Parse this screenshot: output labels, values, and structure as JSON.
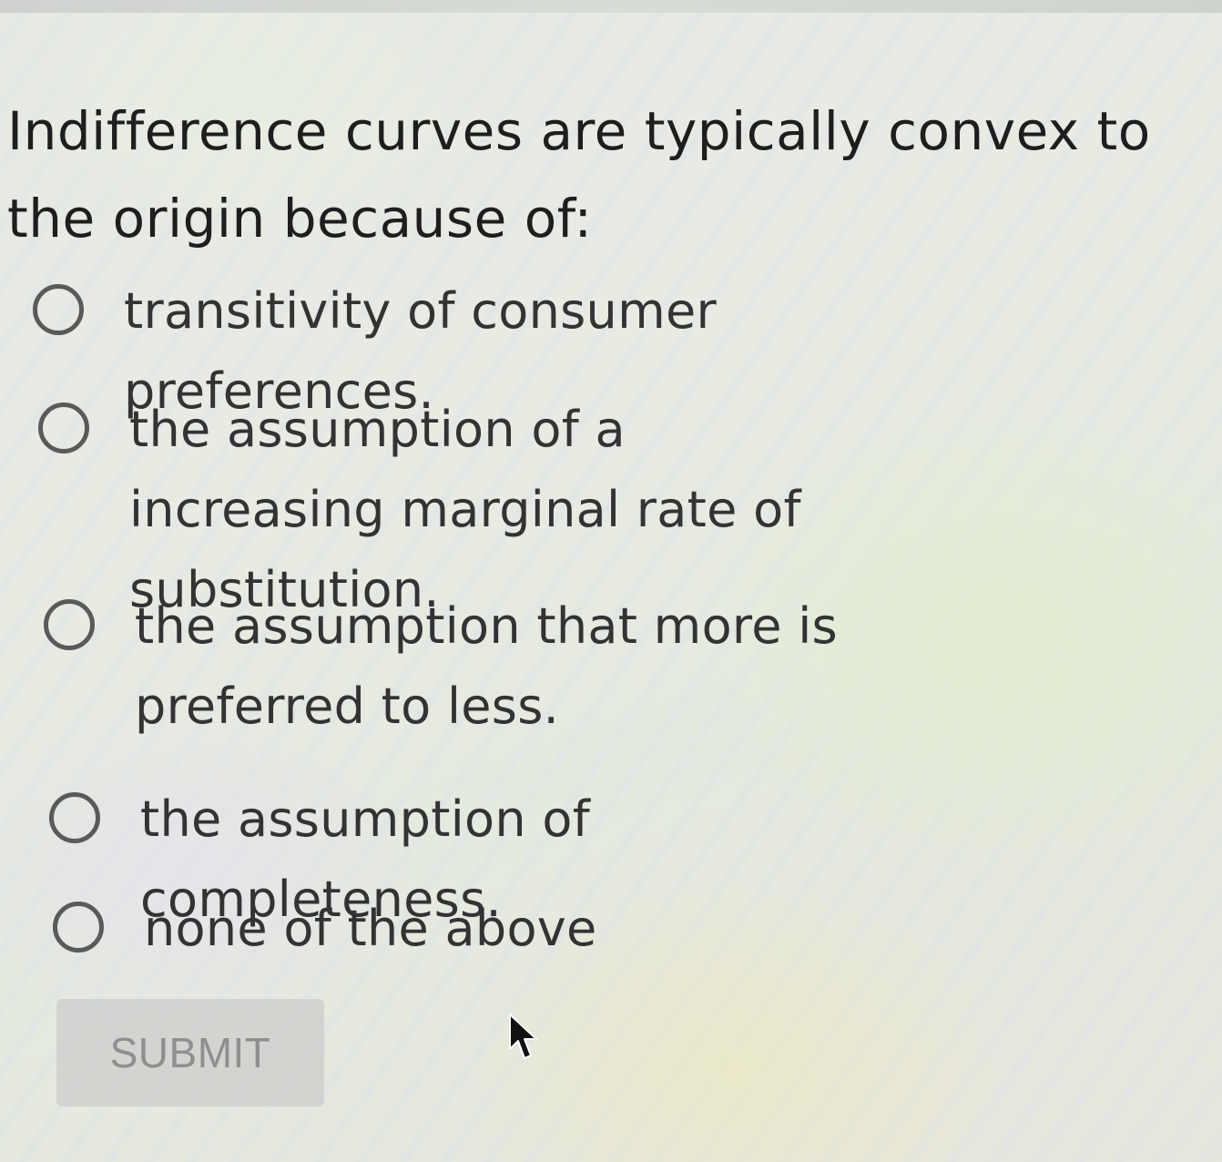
{
  "question": {
    "text": "Indifference curves are typically convex to the origin because of:"
  },
  "options": [
    {
      "label": "transitivity of consumer preferences.",
      "selected": false
    },
    {
      "label": "the assumption of a increasing marginal rate of substitution.",
      "selected": false
    },
    {
      "label": "the assumption that more is preferred to less.",
      "selected": false
    },
    {
      "label": "the assumption of completeness.",
      "selected": false
    },
    {
      "label": "none of the above",
      "selected": false
    }
  ],
  "submit": {
    "label": "SUBMIT",
    "enabled": false
  },
  "colors": {
    "radio_border": "#5a5a5a",
    "submit_background": "#cecfce",
    "submit_text": "#8e8f8e"
  },
  "icons": {
    "cursor": "mouse-pointer-icon"
  }
}
